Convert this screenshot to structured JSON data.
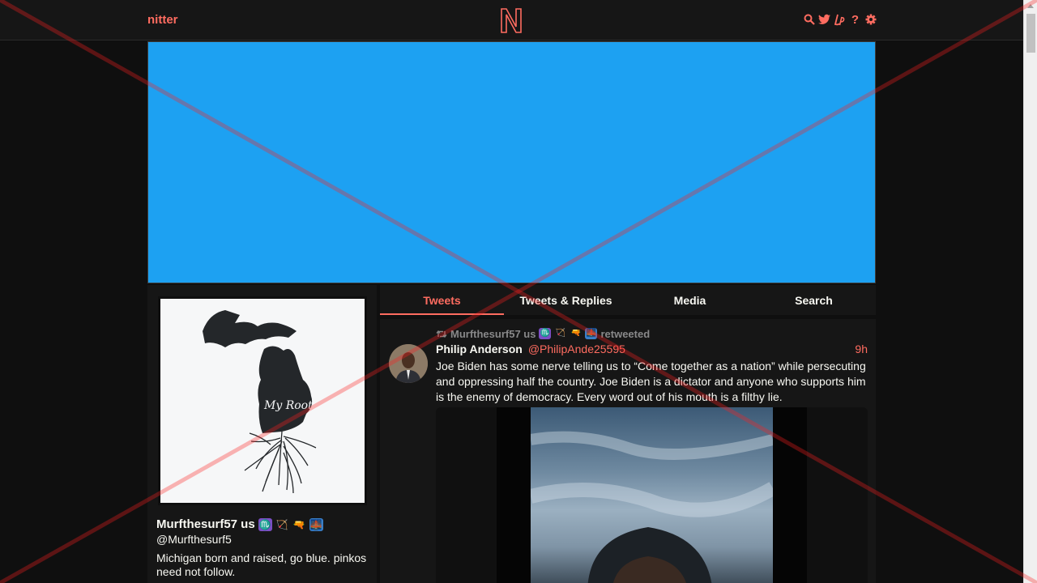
{
  "nav": {
    "brand": "nitter",
    "logo_letter": "N",
    "icons": [
      "search-icon",
      "twitter-icon",
      "liberapay-icon",
      "help-icon",
      "settings-icon"
    ],
    "help_glyph": "?"
  },
  "colors": {
    "accent": "#ff6c60",
    "banner": "#1da1f2",
    "background": "#0f0f0f",
    "panel": "#161616"
  },
  "profile": {
    "fullname": "Murfthesurf57 us",
    "emoji_glyphs": [
      "♏",
      "🏹",
      "🔫",
      "🌉"
    ],
    "handle": "@Murfthesurf5",
    "bio": "Michigan born and raised, go blue. pinkos need not follow.",
    "avatar_text": "My Roots"
  },
  "tabs": [
    {
      "label": "Tweets",
      "active": true
    },
    {
      "label": "Tweets & Replies",
      "active": false
    },
    {
      "label": "Media",
      "active": false
    },
    {
      "label": "Search",
      "active": false
    }
  ],
  "tweet": {
    "retweeter": "Murfthesurf57 us",
    "retweet_suffix": "retweeted",
    "fullname": "Philip Anderson",
    "username": "@PhilipAnde25595",
    "date": "9h",
    "text": "Joe Biden has some nerve telling us to “Come together as a nation” while persecuting and oppressing half the country. Joe Biden is a dictator and anyone who supports him is the enemy of democracy. Every word out of his mouth is a filthy lie."
  }
}
